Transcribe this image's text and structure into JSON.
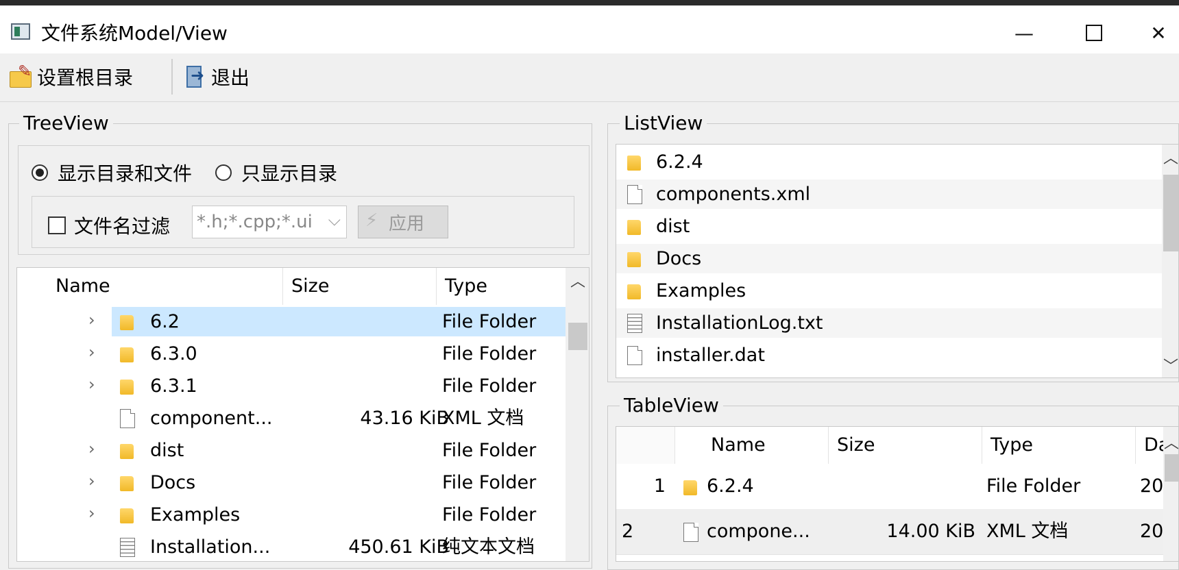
{
  "window": {
    "title": "文件系统Model/View"
  },
  "toolbar": {
    "set_root_label": "设置根目录",
    "exit_label": "退出"
  },
  "tree_group": {
    "title": "TreeView",
    "radio_all": "显示目录和文件",
    "radio_dirs": "只显示目录",
    "filter_label": "文件名过滤",
    "filter_value": "*.h;*.cpp;*.ui",
    "apply_label": "应用",
    "columns": {
      "name": "Name",
      "size": "Size",
      "type": "Type"
    },
    "rows": [
      {
        "name": "6.2",
        "size": "",
        "type": "File Folder",
        "icon": "folder-icon",
        "expandable": true,
        "selected": true
      },
      {
        "name": "6.3.0",
        "size": "",
        "type": "File Folder",
        "icon": "folder-icon",
        "expandable": true
      },
      {
        "name": "6.3.1",
        "size": "",
        "type": "File Folder",
        "icon": "folder-icon",
        "expandable": true
      },
      {
        "name": "component...",
        "size": "43.16 KiB",
        "type": "XML 文档",
        "icon": "file-icon",
        "expandable": false
      },
      {
        "name": "dist",
        "size": "",
        "type": "File Folder",
        "icon": "folder-icon",
        "expandable": true
      },
      {
        "name": "Docs",
        "size": "",
        "type": "File Folder",
        "icon": "folder-icon",
        "expandable": true
      },
      {
        "name": "Examples",
        "size": "",
        "type": "File Folder",
        "icon": "folder-icon",
        "expandable": true
      },
      {
        "name": "Installation...",
        "size": "450.61 KiB",
        "type": "纯文本文档",
        "icon": "text-icon",
        "expandable": false
      }
    ]
  },
  "list_group": {
    "title": "ListView",
    "items": [
      {
        "name": "6.2.4",
        "icon": "folder-icon"
      },
      {
        "name": "components.xml",
        "icon": "file-icon"
      },
      {
        "name": "dist",
        "icon": "folder-icon"
      },
      {
        "name": "Docs",
        "icon": "folder-icon"
      },
      {
        "name": "Examples",
        "icon": "folder-icon"
      },
      {
        "name": "InstallationLog.txt",
        "icon": "text-icon"
      },
      {
        "name": "installer.dat",
        "icon": "file-icon"
      }
    ]
  },
  "table_group": {
    "title": "TableView",
    "columns": {
      "name": "Name",
      "size": "Size",
      "type": "Type",
      "date": "Da"
    },
    "rows": [
      {
        "num": "1",
        "name": "6.2.4",
        "size": "",
        "type": "File Folder",
        "date": "20",
        "icon": "folder-icon"
      },
      {
        "num": "2",
        "name": "compone...",
        "size": "14.00 KiB",
        "type": "XML 文档",
        "date": "20",
        "icon": "file-icon"
      }
    ]
  },
  "colors": {
    "selection": "#cce8ff",
    "folder": "#f1b928",
    "window_bg": "#f0f0f0"
  }
}
